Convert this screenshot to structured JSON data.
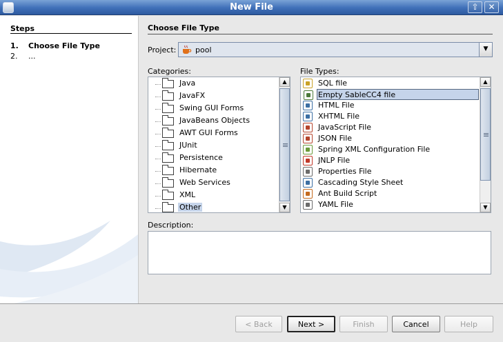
{
  "window": {
    "title": "New File",
    "controls": [
      "maximize-icon",
      "close-icon"
    ]
  },
  "steps": {
    "title": "Steps",
    "items": [
      {
        "num": "1.",
        "label": "Choose File Type"
      },
      {
        "num": "2.",
        "label": "..."
      }
    ]
  },
  "main": {
    "section_title": "Choose File Type",
    "project_label": "Project:",
    "project_value": "pool",
    "categories_label": "Categories:",
    "categories": [
      "Java",
      "JavaFX",
      "Swing GUI Forms",
      "JavaBeans Objects",
      "AWT GUI Forms",
      "JUnit",
      "Persistence",
      "Hibernate",
      "Web Services",
      "XML",
      "Other"
    ],
    "selected_category": "Other",
    "file_types_label": "File Types:",
    "file_types": [
      {
        "label": "SQL file",
        "icon": "sql-file-icon"
      },
      {
        "label": "Empty SableCC4 file",
        "icon": "sablecc-file-icon"
      },
      {
        "label": "HTML File",
        "icon": "html-file-icon"
      },
      {
        "label": "XHTML File",
        "icon": "xhtml-file-icon"
      },
      {
        "label": "JavaScript File",
        "icon": "javascript-file-icon"
      },
      {
        "label": "JSON File",
        "icon": "json-file-icon"
      },
      {
        "label": "Spring XML Configuration File",
        "icon": "spring-xml-file-icon"
      },
      {
        "label": "JNLP File",
        "icon": "jnlp-file-icon"
      },
      {
        "label": "Properties File",
        "icon": "properties-file-icon"
      },
      {
        "label": "Cascading Style Sheet",
        "icon": "css-file-icon"
      },
      {
        "label": "Ant Build Script",
        "icon": "ant-build-file-icon"
      },
      {
        "label": "YAML File",
        "icon": "yaml-file-icon"
      }
    ],
    "selected_file_type": "Empty SableCC4 file",
    "description_label": "Description:",
    "description_text": ""
  },
  "buttons": {
    "back": "< Back",
    "next": "Next >",
    "finish": "Finish",
    "cancel": "Cancel",
    "help": "Help"
  },
  "colors": {
    "title_bar": "#3f6fb8",
    "selection": "#c5d4ea"
  }
}
